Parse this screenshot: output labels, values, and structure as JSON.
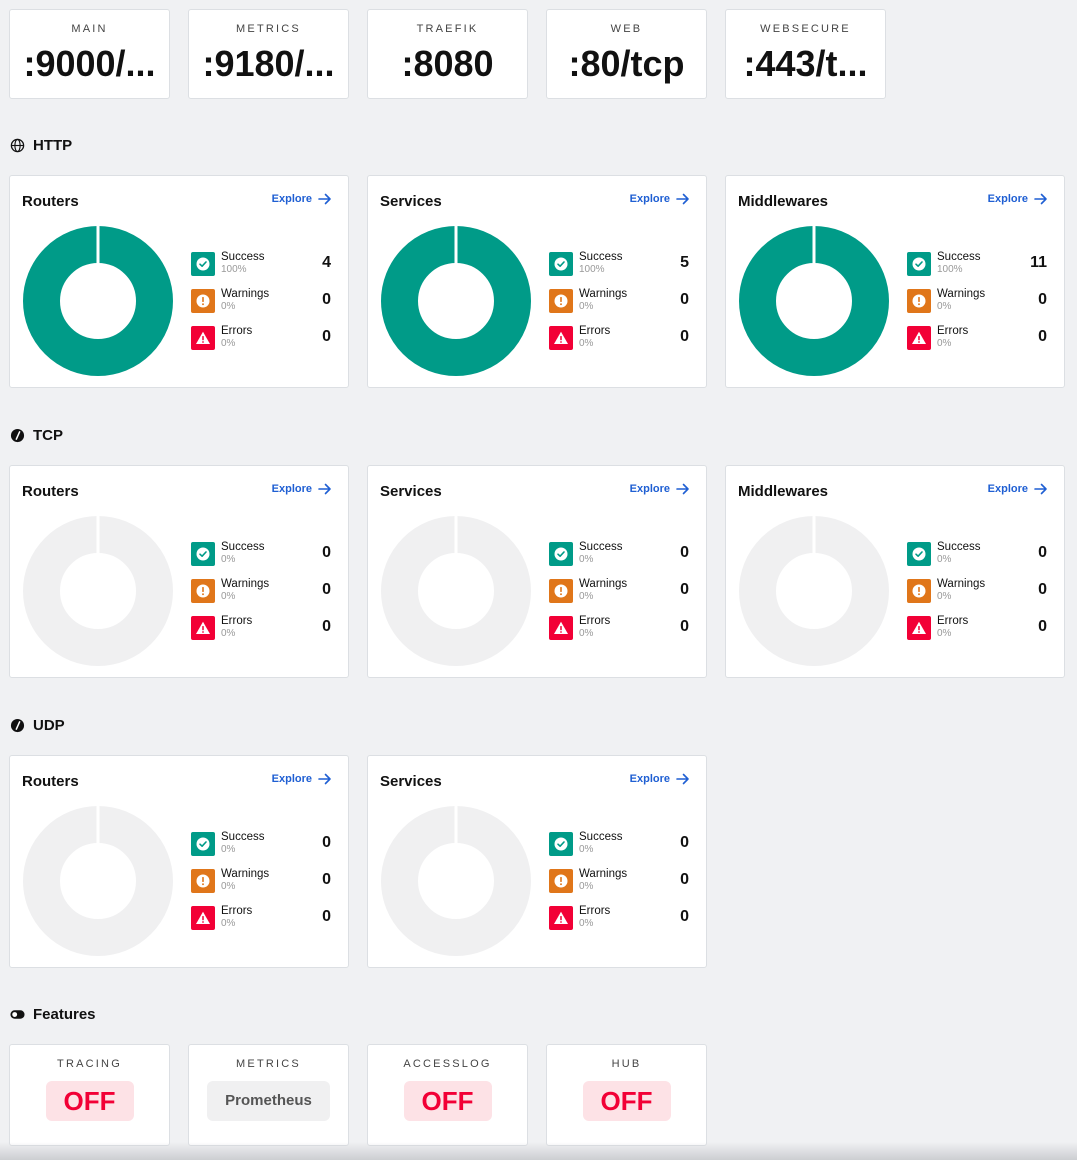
{
  "entrypoints": [
    {
      "name": "MAIN",
      "value": ":9000/..."
    },
    {
      "name": "METRICS",
      "value": ":9180/..."
    },
    {
      "name": "TRAEFIK",
      "value": ":8080"
    },
    {
      "name": "WEB",
      "value": ":80/tcp"
    },
    {
      "name": "WEBSECURE",
      "value": ":443/t..."
    }
  ],
  "colors": {
    "success": "#009b88",
    "warning": "#e0761a",
    "error": "#f20036",
    "empty": "#f0f0f1",
    "link": "#1f5fd3"
  },
  "explore_label": "Explore",
  "sections": [
    {
      "title": "HTTP",
      "icon": "globe-icon",
      "cards": [
        {
          "title": "Routers",
          "success": {
            "label": "Success",
            "pct": "100%",
            "count": "4"
          },
          "warnings": {
            "label": "Warnings",
            "pct": "0%",
            "count": "0"
          },
          "errors": {
            "label": "Errors",
            "pct": "0%",
            "count": "0"
          }
        },
        {
          "title": "Services",
          "success": {
            "label": "Success",
            "pct": "100%",
            "count": "5"
          },
          "warnings": {
            "label": "Warnings",
            "pct": "0%",
            "count": "0"
          },
          "errors": {
            "label": "Errors",
            "pct": "0%",
            "count": "0"
          }
        },
        {
          "title": "Middlewares",
          "success": {
            "label": "Success",
            "pct": "100%",
            "count": "11"
          },
          "warnings": {
            "label": "Warnings",
            "pct": "0%",
            "count": "0"
          },
          "errors": {
            "label": "Errors",
            "pct": "0%",
            "count": "0"
          }
        }
      ]
    },
    {
      "title": "TCP",
      "icon": "tcp-icon",
      "cards": [
        {
          "title": "Routers",
          "success": {
            "label": "Success",
            "pct": "0%",
            "count": "0"
          },
          "warnings": {
            "label": "Warnings",
            "pct": "0%",
            "count": "0"
          },
          "errors": {
            "label": "Errors",
            "pct": "0%",
            "count": "0"
          }
        },
        {
          "title": "Services",
          "success": {
            "label": "Success",
            "pct": "0%",
            "count": "0"
          },
          "warnings": {
            "label": "Warnings",
            "pct": "0%",
            "count": "0"
          },
          "errors": {
            "label": "Errors",
            "pct": "0%",
            "count": "0"
          }
        },
        {
          "title": "Middlewares",
          "success": {
            "label": "Success",
            "pct": "0%",
            "count": "0"
          },
          "warnings": {
            "label": "Warnings",
            "pct": "0%",
            "count": "0"
          },
          "errors": {
            "label": "Errors",
            "pct": "0%",
            "count": "0"
          }
        }
      ]
    },
    {
      "title": "UDP",
      "icon": "udp-icon",
      "cards": [
        {
          "title": "Routers",
          "success": {
            "label": "Success",
            "pct": "0%",
            "count": "0"
          },
          "warnings": {
            "label": "Warnings",
            "pct": "0%",
            "count": "0"
          },
          "errors": {
            "label": "Errors",
            "pct": "0%",
            "count": "0"
          }
        },
        {
          "title": "Services",
          "success": {
            "label": "Success",
            "pct": "0%",
            "count": "0"
          },
          "warnings": {
            "label": "Warnings",
            "pct": "0%",
            "count": "0"
          },
          "errors": {
            "label": "Errors",
            "pct": "0%",
            "count": "0"
          }
        }
      ]
    }
  ],
  "features": {
    "title": "Features",
    "icon": "toggle-icon",
    "items": [
      {
        "name": "TRACING",
        "value": "OFF",
        "state": "off"
      },
      {
        "name": "METRICS",
        "value": "Prometheus",
        "state": "neutral"
      },
      {
        "name": "ACCESSLOG",
        "value": "OFF",
        "state": "off"
      },
      {
        "name": "HUB",
        "value": "OFF",
        "state": "off"
      }
    ]
  }
}
